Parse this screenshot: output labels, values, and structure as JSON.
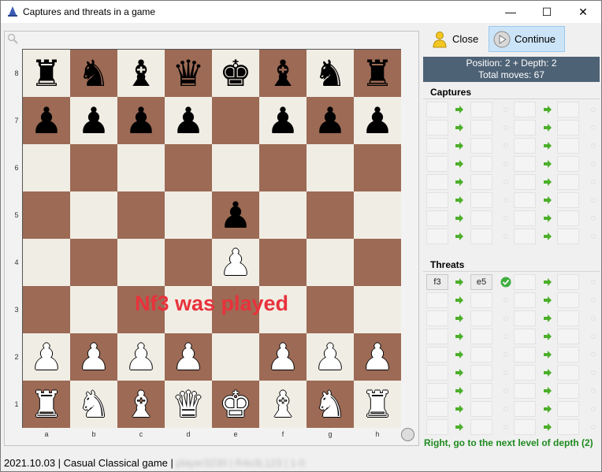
{
  "window": {
    "title": "Captures and threats in a game",
    "min_glyph": "—",
    "max_glyph": "☐",
    "close_glyph": "✕"
  },
  "board": {
    "ranks": [
      "8",
      "7",
      "6",
      "5",
      "4",
      "3",
      "2",
      "1"
    ],
    "files": [
      "a",
      "b",
      "c",
      "d",
      "e",
      "f",
      "g",
      "h"
    ],
    "rows": [
      [
        "br",
        "bn",
        "bb",
        "bq",
        "bk",
        "bb",
        "bn",
        "br"
      ],
      [
        "bp",
        "bp",
        "bp",
        "bp",
        "",
        "bp",
        "bp",
        "bp"
      ],
      [
        "",
        "",
        "",
        "",
        "",
        "",
        "",
        ""
      ],
      [
        "",
        "",
        "",
        "",
        "bp",
        "",
        "",
        ""
      ],
      [
        "",
        "",
        "",
        "",
        "wp",
        "",
        "",
        ""
      ],
      [
        "",
        "",
        "",
        "",
        "",
        "",
        "",
        ""
      ],
      [
        "wp",
        "wp",
        "wp",
        "wp",
        "",
        "wp",
        "wp",
        "wp"
      ],
      [
        "wr",
        "wn",
        "wb",
        "wq",
        "wk",
        "wb",
        "wn",
        "wr"
      ]
    ],
    "overlay_message": "Nf3 was played",
    "light_color": "#f0ede4",
    "dark_color": "#9c6a55"
  },
  "toolbar": {
    "close_label": "Close",
    "continue_label": "Continue"
  },
  "info": {
    "line1": "Position: 2 + Depth: 2",
    "line2": "Total moves: 67"
  },
  "captures": {
    "title": "Captures",
    "rows": [
      [
        "",
        "",
        "",
        ""
      ],
      [
        "",
        "",
        "",
        ""
      ],
      [
        "",
        "",
        "",
        ""
      ],
      [
        "",
        "",
        "",
        ""
      ],
      [
        "",
        "",
        "",
        ""
      ],
      [
        "",
        "",
        "",
        ""
      ],
      [
        "",
        "",
        "",
        ""
      ],
      [
        "",
        "",
        "",
        ""
      ]
    ]
  },
  "threats": {
    "title": "Threats",
    "rows": [
      [
        "f3",
        "e5",
        "",
        ""
      ],
      [
        "",
        "",
        "",
        ""
      ],
      [
        "",
        "",
        "",
        ""
      ],
      [
        "",
        "",
        "",
        ""
      ],
      [
        "",
        "",
        "",
        ""
      ],
      [
        "",
        "",
        "",
        ""
      ],
      [
        "",
        "",
        "",
        ""
      ],
      [
        "",
        "",
        "",
        ""
      ],
      [
        "",
        "",
        "",
        ""
      ]
    ],
    "checked_row": 0
  },
  "status": {
    "hint": "Right, go to the next level of depth (2)",
    "game_info": "2021.10.03 | Casual Classical game | ",
    "blurred_info": "player3230 | R4x3L123 | 1-0"
  },
  "colors": {
    "accent_green": "#1e8a1e",
    "overlay_red": "#e8323c",
    "info_bg": "#4e6276"
  }
}
